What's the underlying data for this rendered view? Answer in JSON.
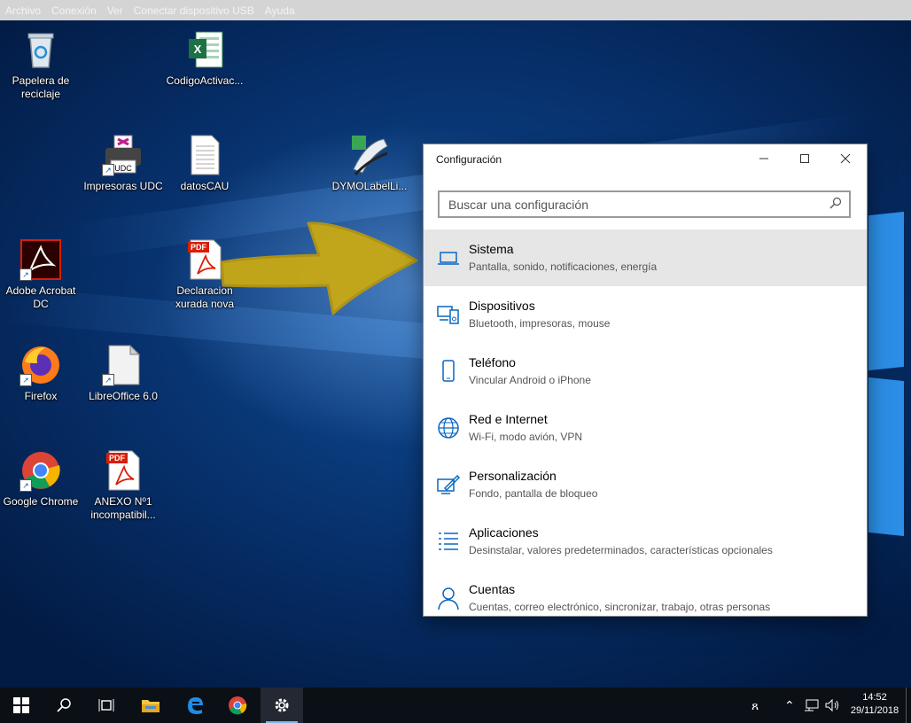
{
  "menubar": {
    "items": [
      "Archivo",
      "Conexión",
      "Ver",
      "Conectar dispositivo USB",
      "Ayuda"
    ]
  },
  "desktop": {
    "icons": [
      {
        "label": "Papelera de reciclaje",
        "icon": "recycle-bin-icon"
      },
      {
        "label": "CodigoActivac...",
        "icon": "excel-file-icon",
        "badge": "X"
      },
      {
        "label": "Impresoras UDC",
        "icon": "printer-icon",
        "badge": "UDC"
      },
      {
        "label": "datosCAU",
        "icon": "text-document-icon"
      },
      {
        "label": "DYMOLabelLi...",
        "icon": "dymo-label-icon"
      },
      {
        "label": "Adobe Acrobat DC",
        "icon": "acrobat-icon"
      },
      {
        "label": "Declaracion xurada nova",
        "icon": "pdf-file-icon",
        "badge": "PDF"
      },
      {
        "label": "Firefox",
        "icon": "firefox-icon"
      },
      {
        "label": "LibreOffice 6.0",
        "icon": "libreoffice-icon"
      },
      {
        "label": "Google Chrome",
        "icon": "chrome-icon"
      },
      {
        "label": "ANEXO Nº1 incompatibil...",
        "icon": "pdf-file-icon",
        "badge": "PDF"
      }
    ]
  },
  "settings": {
    "title": "Configuración",
    "search_placeholder": "Buscar una configuración",
    "items": [
      {
        "title": "Sistema",
        "subtitle": "Pantalla, sonido, notificaciones, energía",
        "icon": "laptop-icon"
      },
      {
        "title": "Dispositivos",
        "subtitle": "Bluetooth, impresoras, mouse",
        "icon": "devices-icon"
      },
      {
        "title": "Teléfono",
        "subtitle": "Vincular Android o iPhone",
        "icon": "phone-icon"
      },
      {
        "title": "Red e Internet",
        "subtitle": "Wi-Fi, modo avión, VPN",
        "icon": "globe-icon"
      },
      {
        "title": "Personalización",
        "subtitle": "Fondo, pantalla de bloqueo",
        "icon": "paint-icon"
      },
      {
        "title": "Aplicaciones",
        "subtitle": "Desinstalar, valores predeterminados, características opcionales",
        "icon": "apps-list-icon"
      },
      {
        "title": "Cuentas",
        "subtitle": "Cuentas, correo electrónico, sincronizar, trabajo, otras personas",
        "icon": "person-icon"
      }
    ],
    "selected_index": 0
  },
  "taskbar": {
    "time": "14:52",
    "date": "29/11/2018"
  },
  "colors": {
    "accent": "#0a66c2",
    "arrow": "#c9a914",
    "taskbar": "#0b0f16"
  }
}
